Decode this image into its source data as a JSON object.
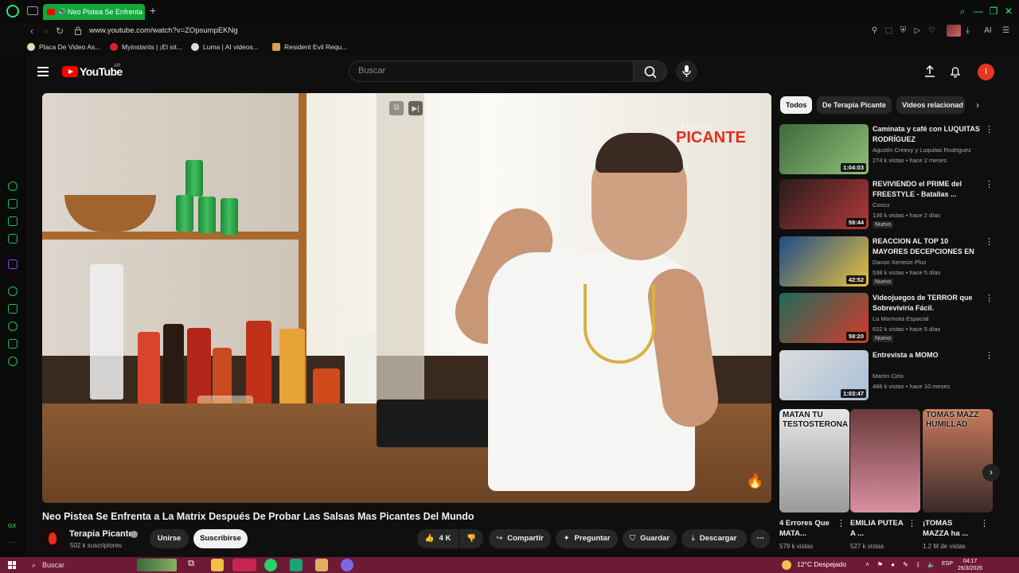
{
  "browser": {
    "tab_title": "Neo Pistea Se Enfrenta",
    "url": "www.youtube.com/watch?v=ZOpsumpEKNg",
    "bookmarks": [
      "Placa De Video As...",
      "Myinstants | ¡El sit...",
      "Luma | AI videos...",
      "Resident Evil Requ..."
    ],
    "ext_ai_label": "AI"
  },
  "youtube": {
    "logo_text": "YouTube",
    "country_code": "AR",
    "search_placeholder": "Buscar",
    "avatar_letter": "I"
  },
  "video": {
    "brand_line1": "TERAPIA",
    "brand_line2": "PICANTE",
    "title": "Neo Pistea Se Enfrenta a La Matrix Después De Probar Las Salsas Mas Picantes Del Mundo",
    "channel": "Terapia Picante",
    "subscribers": "502 k suscriptores",
    "join_label": "Unirse",
    "subscribe_label": "Suscribirse",
    "likes": "4 K",
    "share_label": "Compartir",
    "ask_label": "Preguntar",
    "save_label": "Guardar",
    "download_label": "Descargar"
  },
  "chips": [
    "Todos",
    "De Terapia Picante",
    "Videos relacionad"
  ],
  "recommendations": [
    {
      "title": "Caminata y café con LUQUITAS RODRÍGUEZ",
      "channel": "Agustín Creevy y Luquitas Rodriguez",
      "views": "274 k vistas",
      "age": "hace 2 meses",
      "duration": "1:04:03",
      "badge": "",
      "colors": [
        "#3f6a3a",
        "#8fbf7a"
      ]
    },
    {
      "title": "REVIVIENDO el PRIME del FREESTYLE - Batallas ...",
      "channel": "Coscu",
      "views": "136 k vistas",
      "age": "hace 2 días",
      "duration": "59:44",
      "badge": "Nuevo",
      "colors": [
        "#2a1b1b",
        "#b23a3a"
      ]
    },
    {
      "title": "REACCION AL TOP 10 MAYORES DECEPCIONES EN ...",
      "channel": "Davoo Xeneize Plus",
      "views": "538 k vistas",
      "age": "hace 5 días",
      "duration": "42:52",
      "badge": "Nuevo",
      "colors": [
        "#1d4a8a",
        "#e8c23a"
      ]
    },
    {
      "title": "Videojuegos de TERROR que Sobreviviría Fácil.",
      "channel": "La Marmota Espacial",
      "views": "632 k vistas",
      "age": "hace 5 días",
      "duration": "59:20",
      "badge": "Nuevo",
      "colors": [
        "#1d6b5a",
        "#d83a2a"
      ]
    },
    {
      "title": "Entrevista a MOMO",
      "channel": "Martín Cirio",
      "views": "486 k vistas",
      "age": "hace 10 meses",
      "duration": "1:03:47",
      "badge": "",
      "colors": [
        "#dcdcdc",
        "#a8c0d8"
      ]
    }
  ],
  "shorts": [
    {
      "title": "4 Errores Que MATA...",
      "views": "579 k vistas",
      "overlay": "MATAN TU TESTOSTERONA",
      "colors": [
        "#e6e6e6",
        "#9a9a9a"
      ]
    },
    {
      "title": "EMILIA PUTEA A ...",
      "views": "527 k vistas",
      "overlay": "",
      "colors": [
        "#6b3a3a",
        "#d890a0"
      ]
    },
    {
      "title": "¡TOMAS MAZZA ha ...",
      "views": "1.2 M de vistas",
      "overlay": "TOMAS MAZZ HUMILLAD",
      "colors": [
        "#c87a5a",
        "#3a2a2a"
      ]
    }
  ],
  "taskbar": {
    "search_label": "Buscar",
    "weather": "12°C Despejado",
    "lang": "ESP",
    "time": "04:17",
    "date": "26/3/2026"
  }
}
